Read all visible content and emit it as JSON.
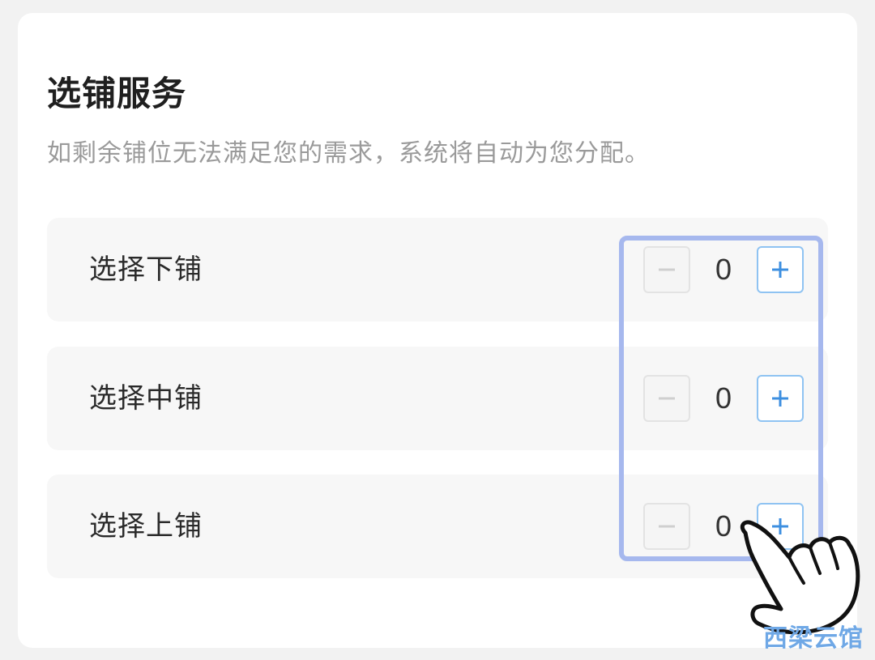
{
  "section": {
    "title": "选铺服务",
    "subtitle": "如剩余铺位无法满足您的需求，系统将自动为您分配。"
  },
  "rows": [
    {
      "label": "选择下铺",
      "quantity": "0"
    },
    {
      "label": "选择中铺",
      "quantity": "0"
    },
    {
      "label": "选择上铺",
      "quantity": "0"
    }
  ],
  "icons": {
    "minus": "minus-icon",
    "plus": "plus-icon",
    "pointer": "hand-pointer-icon"
  },
  "colors": {
    "highlight": "#a6b8ee",
    "plus_border": "#8fc3f2",
    "plus_glyph": "#3d8fe0",
    "minus_glyph": "#cfcfcf",
    "watermark": "#6fa8e6"
  },
  "watermark": "西梁云馆"
}
